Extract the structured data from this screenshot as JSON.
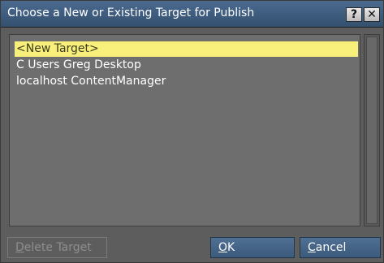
{
  "window": {
    "title": "Choose a New or Existing Target for Publish",
    "help_label": "?",
    "close_label": "✕"
  },
  "list": {
    "items": [
      {
        "label": "<New Target>",
        "selected": true
      },
      {
        "label": "C Users Greg Desktop",
        "selected": false
      },
      {
        "label": "localhost ContentManager",
        "selected": false
      }
    ]
  },
  "buttons": {
    "delete": {
      "mnemonic": "D",
      "rest": "elete Target",
      "enabled": false
    },
    "ok": {
      "mnemonic": "O",
      "rest": "K"
    },
    "cancel": {
      "mnemonic": "C",
      "rest": "ancel"
    }
  },
  "colors": {
    "titlebar": "#3f5f82",
    "selection": "#f8f07a",
    "dialog_bg": "#5d5d5d",
    "button_blue": "#45658a"
  }
}
